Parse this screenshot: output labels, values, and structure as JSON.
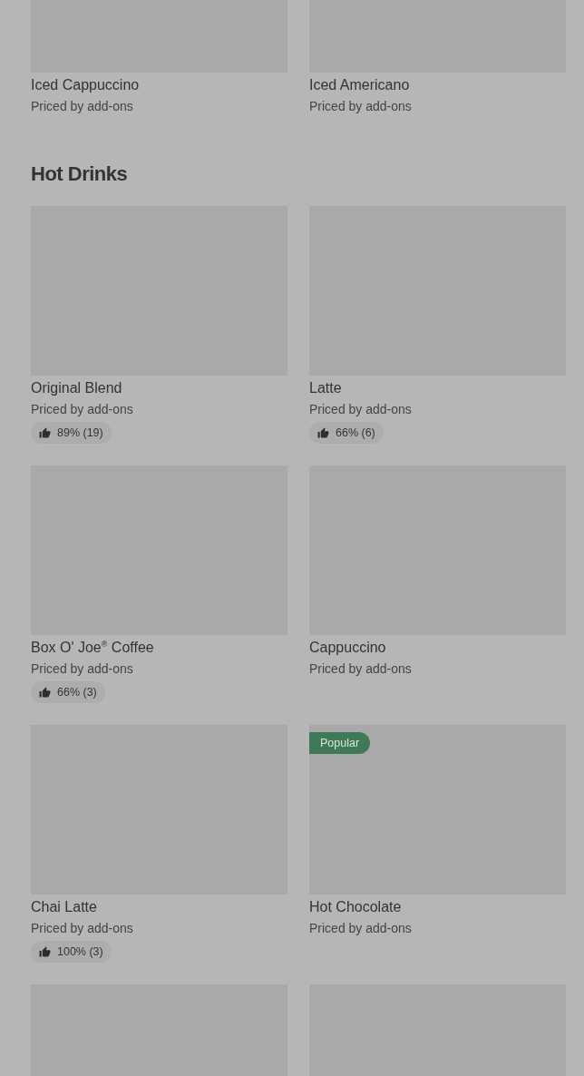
{
  "sections": [
    {
      "rows": [
        [
          {
            "kind": "product",
            "name": "Iced Cappuccino",
            "price": "Priced by add-ons"
          },
          {
            "kind": "product",
            "name": "Iced Americano",
            "price": "Priced by add-ons"
          }
        ]
      ]
    },
    {
      "title": "Hot Drinks",
      "rows": [
        [
          {
            "kind": "product",
            "name": "Original Blend",
            "price": "Priced by add-ons",
            "rating": "89% (19)"
          },
          {
            "kind": "product",
            "name": "Latte",
            "price": "Priced by add-ons",
            "rating": "66% (6)"
          }
        ],
        [
          {
            "kind": "product",
            "name": "Box O' Joe$^{®}$ Coffee",
            "price": "Priced by add-ons",
            "rating": "66% (3)"
          },
          {
            "kind": "product",
            "name": "Cappuccino",
            "price": "Priced by add-ons"
          }
        ],
        [
          {
            "kind": "product",
            "name": "Chai Latte",
            "price": "Priced by add-ons",
            "rating": "100% (3)"
          },
          {
            "kind": "product",
            "name": "Hot Chocolate",
            "price": "Priced by add-ons",
            "badge": "Popular"
          }
        ],
        [
          {
            "kind": "photo"
          },
          {
            "kind": "photo"
          }
        ]
      ]
    }
  ]
}
